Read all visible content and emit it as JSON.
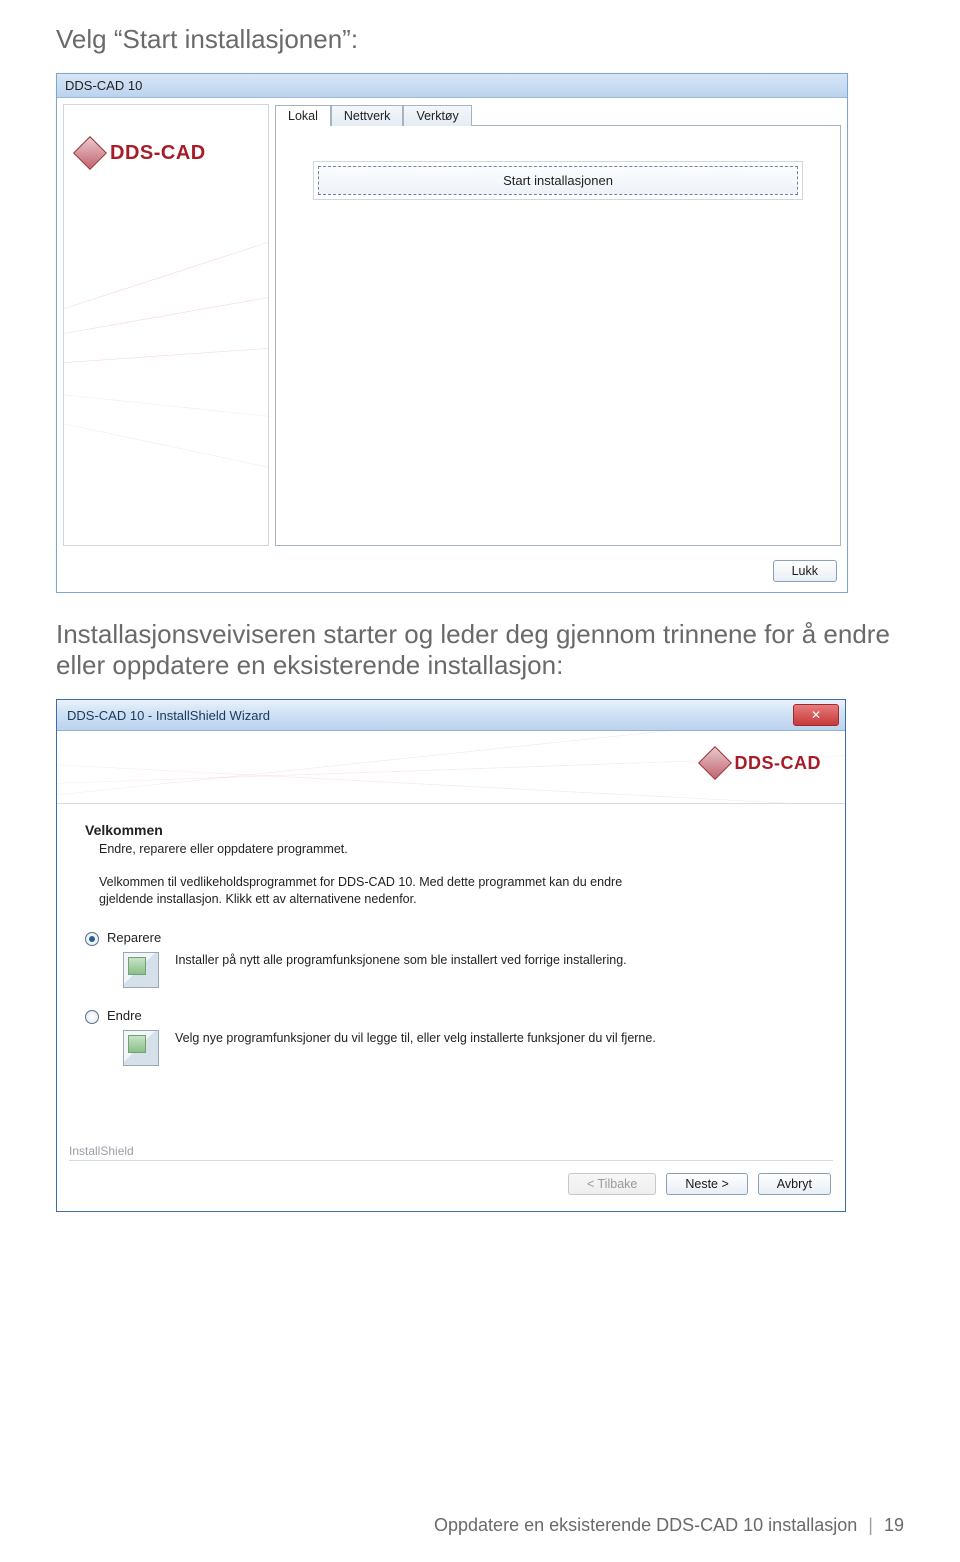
{
  "intro1": "Velg “Start installasjonen”:",
  "intro2": "Installasjonsveiviseren starter og leder deg gjennom trinnene for å endre eller oppdatere en eksisterende installasjon:",
  "win1": {
    "title": "DDS-CAD 10",
    "brand": "DDS-CAD",
    "tabs": [
      "Lokal",
      "Nettverk",
      "Verktøy"
    ],
    "active_tab_index": 0,
    "start_button": "Start installasjonen",
    "close_button": "Lukk"
  },
  "win2": {
    "title": "DDS-CAD 10 - InstallShield Wizard",
    "brand": "DDS-CAD",
    "heading": "Velkommen",
    "subheading": "Endre, reparere eller oppdatere programmet.",
    "description": "Velkommen til vedlikeholdsprogrammet for DDS-CAD 10. Med dette programmet kan du endre gjeldende installasjon. Klikk ett av alternativene nedenfor.",
    "options": [
      {
        "label": "Reparere",
        "selected": true,
        "text": "Installer på nytt alle programfunksjonene som ble installert ved forrige installering."
      },
      {
        "label": "Endre",
        "selected": false,
        "text": "Velg nye programfunksjoner du vil legge til, eller velg installerte funksjoner du vil fjerne."
      }
    ],
    "installshield_label": "InstallShield",
    "buttons": {
      "back": "< Tilbake",
      "next": "Neste >",
      "cancel": "Avbryt"
    }
  },
  "footer": {
    "text": "Oppdatere en eksisterende DDS-CAD 10 installasjon",
    "page": "19"
  }
}
